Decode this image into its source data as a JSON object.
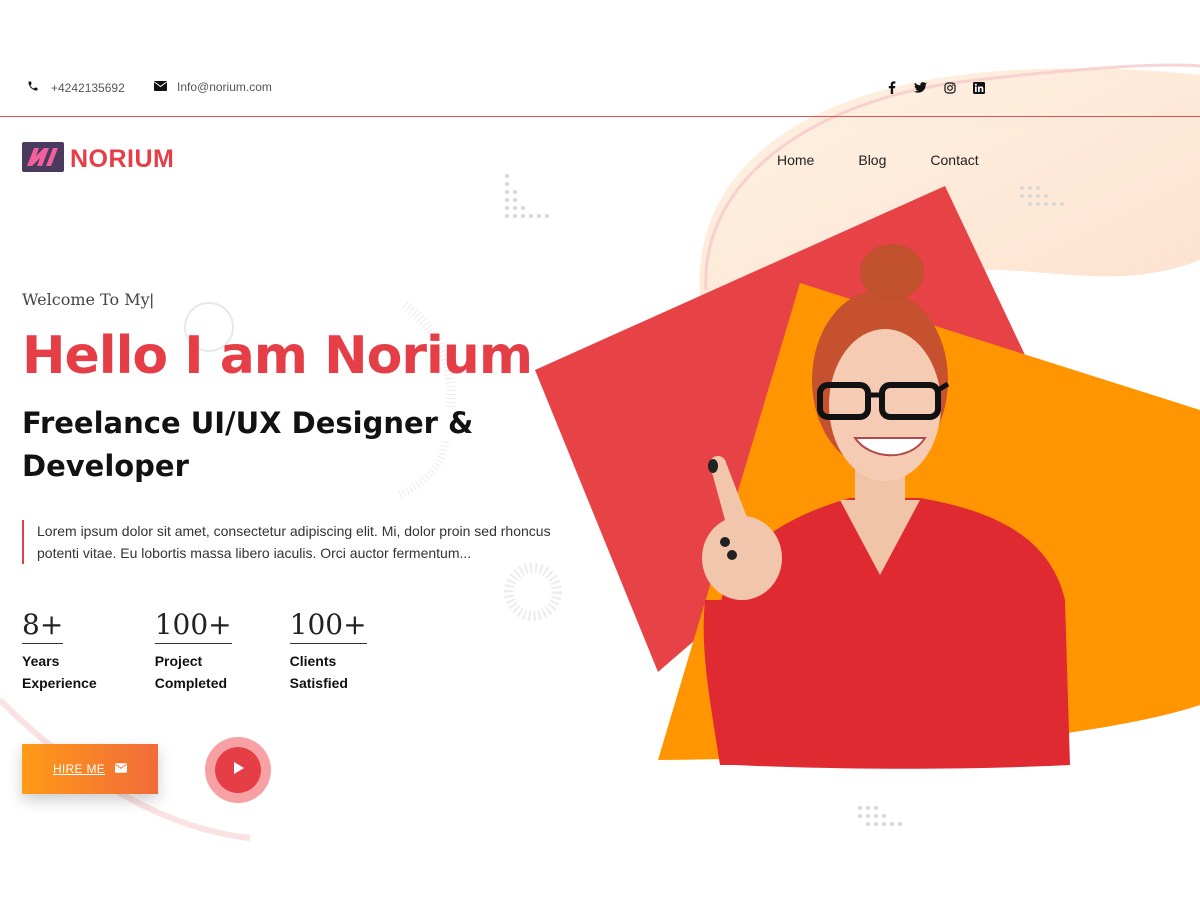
{
  "topbar": {
    "phone": "+4242135692",
    "email": "Info@norium.com",
    "social": [
      "facebook-icon",
      "twitter-icon",
      "instagram-icon",
      "linkedin-icon"
    ]
  },
  "header": {
    "logo_text": "NORIUM",
    "nav": [
      {
        "label": "Home"
      },
      {
        "label": "Blog"
      },
      {
        "label": "Contact"
      }
    ]
  },
  "hero": {
    "welcome": "Welcome To My",
    "title": "Hello I am Norium",
    "subtitle": "Freelance UI/UX Designer & Developer",
    "description": "Lorem ipsum dolor sit amet, consectetur adipiscing elit. Mi, dolor proin sed rhoncus potenti vitae. Eu lobortis massa libero iaculis. Orci auctor fermentum...",
    "stats": [
      {
        "value": "8+",
        "label": "Years\nExperience"
      },
      {
        "value": "100+",
        "label": "Project\nCompleted"
      },
      {
        "value": "100+",
        "label": "Clients\nSatisfied"
      }
    ],
    "hire_label": "HIRE ME",
    "play_icon": "play-icon"
  },
  "colors": {
    "accent": "#e53e46",
    "orange": "#ff9500",
    "blob": "#fde9d4"
  }
}
